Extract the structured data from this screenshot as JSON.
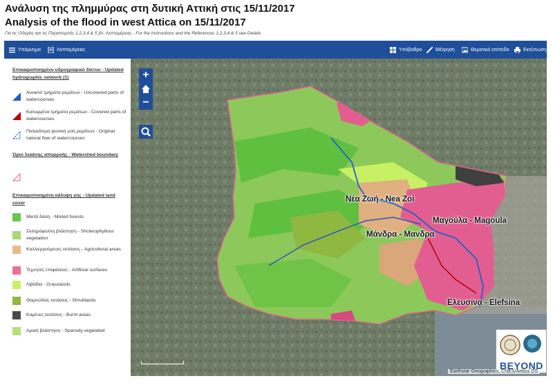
{
  "header": {
    "title_gr": "Ανάλυση της πλημμύρας στη δυτική Αττική στις 15/11/2017",
    "title_en": "Analysis of the flood in west Attica on 15/11/2017",
    "subtitle": "Για τις Οδηγίες και τις Παραπομπές 1,2,3,4 & 5 βλ. Λεπτομέρειες - For the Instructions and the References 1,2,3,4 & 5 see Details"
  },
  "toolbar": {
    "legend": "Υπόμνημα",
    "details": "Λεπτομέρειες",
    "basemap": "Υπόβαθρο",
    "measure": "Μέτρηση",
    "share": "Θεματικό επίπεδο",
    "print": "Εκτύπωση"
  },
  "legend": {
    "hydro_title": "Επικαιροποιημένο υδρογραφικό δίκτυο - Updated hydrographic network (1)",
    "hydro_items": [
      {
        "label": "Ανοικτά τμήματα ρεμάτων - Uncovered parts of watercourses",
        "color": "#1f5fd0"
      },
      {
        "label": "Καλυμμένα τμήματα ρεμάτων - Covered parts of watercourses",
        "color": "#c00000"
      },
      {
        "label": "Παλαιότερη φυσική ροή ρεμάτων - Original natural flow of watercourses",
        "color": "#1f5fd0"
      }
    ],
    "watershed_title": "Όριο λεκάνης απορροής - Watershed boundary",
    "landcover_title": "Επικαιροποιημένη κάλυψη γης - Updated land cover",
    "landcover_items": [
      {
        "label": "Μικτά δάση - Mixted forests",
        "color": "#66c84a"
      },
      {
        "label": "Σκληρόφυλλη βλάστηση - Shclerophyllous vegetation",
        "color": "#a8d878"
      },
      {
        "label": "Καλλιεργούμενες εκτάσεις - Agricultural areas",
        "color": "#e9b98a"
      },
      {
        "label": "Τεχνητές επιφάνειες - Artificial surfaces",
        "color": "#e8709a"
      },
      {
        "label": "Λιβάδια - Grasslands",
        "color": "#c8f064"
      },
      {
        "label": "Θαμνώδεις εκτάσεις - Shrublands",
        "color": "#8fb840"
      },
      {
        "label": "Καμένες εκτάσεις - Burnt areas",
        "color": "#4a4a4a"
      },
      {
        "label": "Αραιή βλάστηση - Sparsely vegetated",
        "color": "#b5e07a"
      }
    ]
  },
  "map": {
    "places": [
      {
        "name": "Νέα Ζωή - Nea Zoi"
      },
      {
        "name": "Μαγούλα - Magoula"
      },
      {
        "name": "Μάνδρα - Μανδρα"
      },
      {
        "name": "Ελευσίνα - Elefsina"
      }
    ],
    "attribution": "Earthstar Geographics, CNES/Airbus DS",
    "logo_text": "BEYOND"
  }
}
